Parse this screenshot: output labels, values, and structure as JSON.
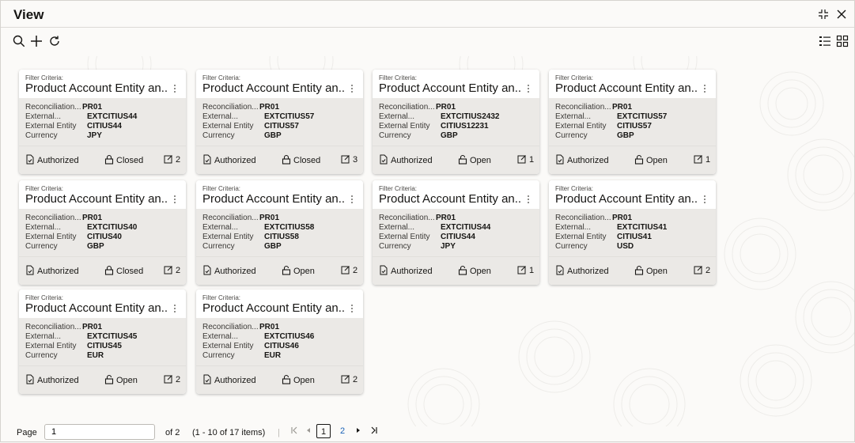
{
  "window": {
    "title": "View"
  },
  "card_labels": {
    "filter_criteria": "Filter Criteria:",
    "reconciliation": "Reconciliation...",
    "external": "External...",
    "external_entity": "External Entity",
    "currency": "Currency"
  },
  "cards": [
    {
      "title": "Product Account Entity an...",
      "reconciliation": "PR01",
      "external": "EXTCITIUS44",
      "external_entity": "CITIUS44",
      "currency": "JPY",
      "auth_status": "Authorized",
      "record_status": "Closed",
      "record_icon": "lock-closed-icon",
      "mod_count": "2"
    },
    {
      "title": "Product Account Entity an...",
      "reconciliation": "PR01",
      "external": "EXTCITIUS57",
      "external_entity": "CITIUS57",
      "currency": "GBP",
      "auth_status": "Authorized",
      "record_status": "Closed",
      "record_icon": "lock-closed-icon",
      "mod_count": "3"
    },
    {
      "title": "Product Account Entity an...",
      "reconciliation": "PR01",
      "external": "EXTCITIUS2432",
      "external_entity": "CITIUS12231",
      "currency": "GBP",
      "auth_status": "Authorized",
      "record_status": "Open",
      "record_icon": "lock-open-icon",
      "mod_count": "1"
    },
    {
      "title": "Product Account Entity an...",
      "reconciliation": "PR01",
      "external": "EXTCITIUS57",
      "external_entity": "CITIUS57",
      "currency": "GBP",
      "auth_status": "Authorized",
      "record_status": "Open",
      "record_icon": "lock-open-icon",
      "mod_count": "1"
    },
    {
      "title": "Product Account Entity an...",
      "reconciliation": "PR01",
      "external": "EXTCITIUS40",
      "external_entity": "CITIUS40",
      "currency": "GBP",
      "auth_status": "Authorized",
      "record_status": "Closed",
      "record_icon": "lock-closed-icon",
      "mod_count": "2"
    },
    {
      "title": "Product Account Entity an...",
      "reconciliation": "PR01",
      "external": "EXTCITIUS58",
      "external_entity": "CITIUS58",
      "currency": "GBP",
      "auth_status": "Authorized",
      "record_status": "Open",
      "record_icon": "lock-open-icon",
      "mod_count": "2"
    },
    {
      "title": "Product Account Entity an...",
      "reconciliation": "PR01",
      "external": "EXTCITIUS44",
      "external_entity": "CITIUS44",
      "currency": "JPY",
      "auth_status": "Authorized",
      "record_status": "Open",
      "record_icon": "lock-open-icon",
      "mod_count": "1"
    },
    {
      "title": "Product Account Entity an...",
      "reconciliation": "PR01",
      "external": "EXTCITIUS41",
      "external_entity": "CITIUS41",
      "currency": "USD",
      "auth_status": "Authorized",
      "record_status": "Open",
      "record_icon": "lock-open-icon",
      "mod_count": "2"
    },
    {
      "title": "Product Account Entity an...",
      "reconciliation": "PR01",
      "external": "EXTCITIUS45",
      "external_entity": "CITIUS45",
      "currency": "EUR",
      "auth_status": "Authorized",
      "record_status": "Open",
      "record_icon": "lock-open-icon",
      "mod_count": "2"
    },
    {
      "title": "Product Account Entity an...",
      "reconciliation": "PR01",
      "external": "EXTCITIUS46",
      "external_entity": "CITIUS46",
      "currency": "EUR",
      "auth_status": "Authorized",
      "record_status": "Open",
      "record_icon": "lock-open-icon",
      "mod_count": "2"
    }
  ],
  "pagination": {
    "page_label": "Page",
    "page_value": "1",
    "of_label": "of 2",
    "items_label": "(1 - 10 of 17 items)",
    "pages": [
      "1",
      "2"
    ],
    "current_page": "1"
  },
  "icons": {
    "toolbar": [
      "search-icon",
      "add-icon",
      "refresh-icon"
    ],
    "view_toggles": [
      "list-view-icon",
      "tile-view-icon"
    ],
    "window": [
      "minimize-icon",
      "close-icon"
    ]
  },
  "colors": {
    "link": "#1b62b7",
    "card_body": "#ebe9e6",
    "card_head": "#ffffff"
  }
}
